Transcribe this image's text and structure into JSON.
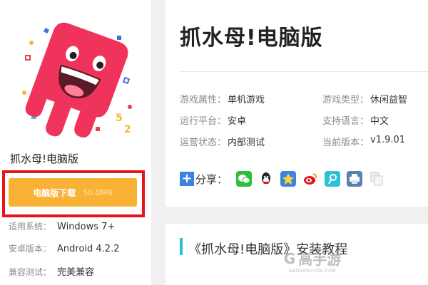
{
  "app": {
    "name": "抓水母!电脑版",
    "download_label": "电脑版下载",
    "download_size": "50.0MB",
    "specs": [
      {
        "key": "适用系统：",
        "value": "Windows 7+"
      },
      {
        "key": "安卓版本：",
        "value": "Android 4.2.2"
      },
      {
        "key": "兼容测试：",
        "value": "完美兼容"
      }
    ]
  },
  "info": {
    "title": "抓水母!电脑版",
    "attributes": [
      {
        "key": "游戏属性：",
        "value": "单机游戏"
      },
      {
        "key": "游戏类型：",
        "value": "休闲益智"
      },
      {
        "key": "运行平台：",
        "value": "安卓"
      },
      {
        "key": "支持语言：",
        "value": "中文"
      },
      {
        "key": "运营状态：",
        "value": "内部测试"
      },
      {
        "key": "当前版本：",
        "value": "v1.9.01"
      }
    ],
    "share_label": "分享：",
    "share_icons": [
      "wechat-icon",
      "qq-icon",
      "qzone-icon",
      "weibo-icon",
      "tencent-weibo-icon",
      "print-icon",
      "copy-icon"
    ]
  },
  "tutorial": {
    "title": "《抓水母!电脑版》安装教程"
  },
  "watermark": {
    "logo_text": "G",
    "logo_name": "高手游",
    "url": "GAOSHOUYOU.COM"
  },
  "colors": {
    "download_button": "#f9b236",
    "highlight_frame": "#e8141b",
    "accent_bar": "#2ac0d6",
    "jelly": "#f0335b"
  }
}
